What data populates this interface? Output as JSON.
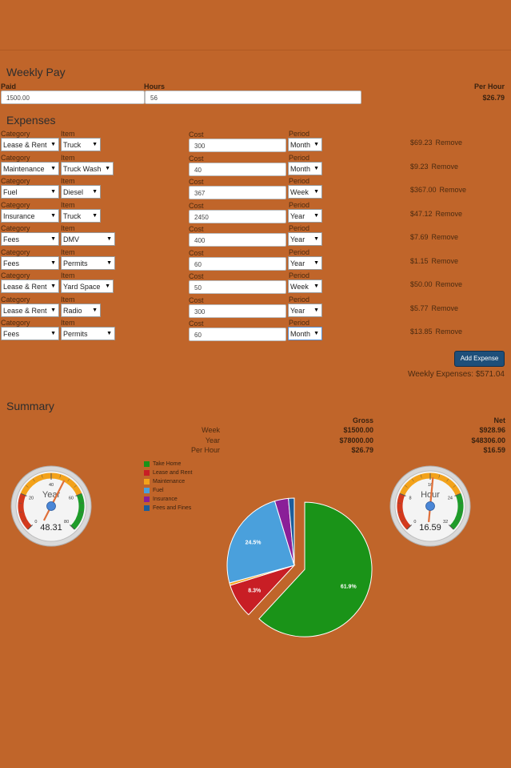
{
  "weekly_pay": {
    "title": "Weekly Pay",
    "paid_label": "Paid",
    "paid_value": "1500.00",
    "hours_label": "Hours",
    "hours_value": "56",
    "per_hour_label": "Per Hour",
    "per_hour_value": "$26.79"
  },
  "expenses": {
    "title": "Expenses",
    "labels": {
      "category": "Category",
      "item": "Item",
      "cost": "Cost",
      "period": "Period"
    },
    "remove_label": "Remove",
    "rows": [
      {
        "category": "Lease & Rent",
        "item": "Truck",
        "cost": "300",
        "period": "Month",
        "weekly": "$69.23"
      },
      {
        "category": "Maintenance",
        "item": "Truck Wash",
        "cost": "40",
        "period": "Month",
        "weekly": "$9.23"
      },
      {
        "category": "Fuel",
        "item": "Diesel",
        "cost": "367",
        "period": "Week",
        "weekly": "$367.00"
      },
      {
        "category": "Insurance",
        "item": "Truck",
        "cost": "2450",
        "period": "Year",
        "weekly": "$47.12"
      },
      {
        "category": "Fees",
        "item": "DMV",
        "cost": "400",
        "period": "Year",
        "weekly": "$7.69"
      },
      {
        "category": "Fees",
        "item": "Permits",
        "cost": "60",
        "period": "Year",
        "weekly": "$1.15"
      },
      {
        "category": "Lease & Rent",
        "item": "Yard Space",
        "cost": "50",
        "period": "Week",
        "weekly": "$50.00"
      },
      {
        "category": "Lease & Rent",
        "item": "Radio",
        "cost": "300",
        "period": "Year",
        "weekly": "$5.77"
      },
      {
        "category": "Fees",
        "item": "Permits",
        "cost": "60",
        "period": "Month",
        "weekly": "$13.85"
      }
    ],
    "add_button": "Add Expense",
    "weekly_total": "Weekly Expenses: $571.04"
  },
  "summary": {
    "title": "Summary",
    "gross_label": "Gross",
    "net_label": "Net",
    "rows": [
      {
        "label": "Week",
        "gross": "$1500.00",
        "net": "$928.96"
      },
      {
        "label": "Year",
        "gross": "$78000.00",
        "net": "$48306.00"
      },
      {
        "label": "Per Hour",
        "gross": "$26.79",
        "net": "$16.59"
      }
    ]
  },
  "gauges": [
    {
      "label": "Year",
      "value": "48.31",
      "ticks": [
        "0",
        "20",
        "40",
        "60",
        "80"
      ],
      "fraction": 0.6
    },
    {
      "label": "Hour",
      "value": "16.59",
      "ticks": [
        "0",
        "8",
        "16",
        "24",
        "32"
      ],
      "fraction": 0.52
    }
  ],
  "chart_data": {
    "type": "pie",
    "legend_position": "top-left",
    "slices": [
      {
        "name": "Take Home",
        "value": 61.9,
        "label": "61.9%",
        "color": "#1a9318",
        "exploded": true
      },
      {
        "name": "Lease and Rent",
        "value": 8.3,
        "label": "8.3%",
        "color": "#c81e25"
      },
      {
        "name": "Maintenance",
        "value": 0.6,
        "label": "",
        "color": "#f3a21a"
      },
      {
        "name": "Fuel",
        "value": 24.5,
        "label": "24.5%",
        "color": "#4aa0dc"
      },
      {
        "name": "Insurance",
        "value": 3.3,
        "label": "",
        "color": "#8a1f98"
      },
      {
        "name": "Fees and Fines",
        "value": 1.4,
        "label": "",
        "color": "#1c5d9b"
      }
    ]
  }
}
